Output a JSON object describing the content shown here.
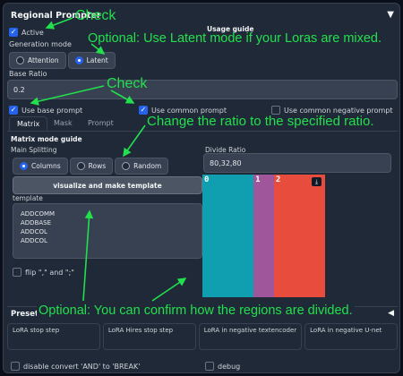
{
  "panel": {
    "title": "Regional Prompter",
    "collapse_icon": "triangle-down-icon"
  },
  "active": {
    "label": "Active",
    "checked": true
  },
  "usage_guide": "Usage guide",
  "generation_mode": {
    "label": "Generation mode",
    "options": [
      "Attention",
      "Latent"
    ],
    "selected": "Latent"
  },
  "base_ratio": {
    "label": "Base Ratio",
    "value": "0.2"
  },
  "checkboxes": {
    "use_base_prompt": {
      "label": "Use base prompt",
      "checked": true
    },
    "use_common_prompt": {
      "label": "Use common prompt",
      "checked": true
    },
    "use_common_negative_prompt": {
      "label": "Use common negative prompt",
      "checked": false
    }
  },
  "tabs": [
    "Matrix",
    "Mask",
    "Prompt"
  ],
  "active_tab": "Matrix",
  "matrix": {
    "guide_title": "Matrix mode guide",
    "main_splitting_label": "Main Splitting",
    "splitting_options": [
      "Columns",
      "Rows",
      "Random"
    ],
    "splitting_selected": "Columns",
    "divide_ratio_label": "Divide Ratio",
    "divide_ratio_value": "80,32,80",
    "visualize_button": "visualize and make template",
    "template_label": "template",
    "template_lines": [
      "ADDCOMM",
      "ADDBASE",
      "ADDCOL",
      "ADDCOL"
    ],
    "flip_label": "flip \",\" and \";\"",
    "flip_checked": false,
    "regions": [
      {
        "label": "0",
        "ratio": 80,
        "color": "#0f9fb0"
      },
      {
        "label": "1",
        "ratio": 32,
        "color": "#a0569a"
      },
      {
        "label": "2",
        "ratio": 80,
        "color": "#e74c3c"
      }
    ],
    "download_icon": "download-icon"
  },
  "presets": {
    "label": "Presets",
    "icon": "triangle-left-icon"
  },
  "lora": [
    {
      "label": "LoRA stop step"
    },
    {
      "label": "LoRA Hires stop step"
    },
    {
      "label": "LoRA in negative textencoder"
    },
    {
      "label": "LoRA in negative U-net"
    }
  ],
  "bottom_checks": {
    "disable_convert": {
      "label": "disable convert 'AND' to 'BREAK'",
      "checked": false
    },
    "debug": {
      "label": "debug",
      "checked": false
    }
  },
  "annotations": {
    "check1": "Check",
    "optional_latent": "Optional: Use Latent mode if your Loras are mixed.",
    "check2": "Check",
    "change_ratio": "Change the ratio to the specified ratio.",
    "confirm_regions": "Optional: You can confirm how the regions are divided."
  },
  "colors": {
    "annotation": "#22e04d",
    "accent": "#2563eb"
  }
}
